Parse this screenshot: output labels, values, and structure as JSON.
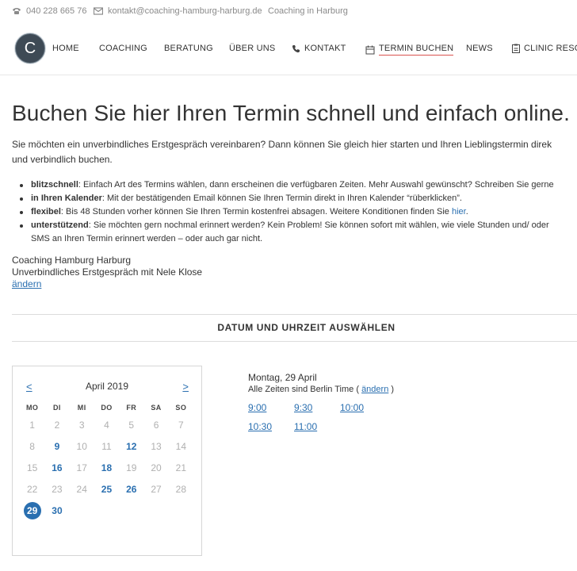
{
  "topbar": {
    "phone": "040 228 665 76",
    "email": "kontakt@coaching-hamburg-harburg.de",
    "tagline": "Coaching in Harburg"
  },
  "logo": {
    "letter": "C"
  },
  "nav": {
    "home": "HOME",
    "coaching": "COACHING",
    "beratung": "BERATUNG",
    "ueber_uns": "ÜBER UNS",
    "kontakt": "KONTAKT",
    "termin": "TERMIN BUCHEN",
    "news": "NEWS",
    "clinic": "CLINIC RESOU"
  },
  "headline": "Buchen Sie hier Ihren Termin schnell und einfach online.",
  "intro": {
    "line1": "Sie möchten ein unverbindliches Erstgespräch vereinbaren? Dann können Sie gleich hier starten und Ihren Lieblingstermin direk",
    "line2": "und verbindlich buchen."
  },
  "bullets": [
    {
      "bold": "blitzschnell",
      "text": ": Einfach Art des Termins wählen, dann erscheinen die verfügbaren Zeiten. Mehr Auswahl gewünscht? Schreiben Sie gerne"
    },
    {
      "bold": "in Ihren Kalender",
      "text": ": Mit der bestätigenden Email können Sie Ihren Termin direkt in Ihren Kalender “rüberklicken”."
    },
    {
      "bold": "flexibel",
      "text": ": Bis 48 Stunden vorher können Sie Ihren Termin kostenfrei absagen. Weitere Konditionen finden Sie ",
      "link": "hier",
      "after": "."
    },
    {
      "bold": "unterstützend",
      "text": ": Sie möchten gern nochmal erinnert werden? Kein Problem! Sie können sofort mit wählen, wie viele Stunden und/ oder",
      "cont": "SMS an Ihren Termin erinnert werden – oder auch gar nicht."
    }
  ],
  "booking": {
    "business": "Coaching Hamburg Harburg",
    "service": "Unverbindliches Erstgespräch mit Nele Klose",
    "change": "ändern"
  },
  "section_title": "DATUM UND UHRZEIT AUSWÄHLEN",
  "calendar": {
    "prev": "<",
    "next": ">",
    "month": "April 2019",
    "weekdays": [
      "MO",
      "DI",
      "MI",
      "DO",
      "FR",
      "SA",
      "SO"
    ],
    "weeks": [
      [
        "1",
        "2",
        "3",
        "4",
        "5",
        "6",
        "7"
      ],
      [
        "8",
        "9",
        "10",
        "11",
        "12",
        "13",
        "14"
      ],
      [
        "15",
        "16",
        "17",
        "18",
        "19",
        "20",
        "21"
      ],
      [
        "22",
        "23",
        "24",
        "25",
        "26",
        "27",
        "28"
      ],
      [
        "29",
        "30"
      ]
    ],
    "available": [
      "9",
      "12",
      "16",
      "18",
      "25",
      "26",
      "29",
      "30"
    ],
    "selected": "29"
  },
  "times": {
    "date": "Montag, 29 April",
    "tz_prefix": "Alle Zeiten sind Berlin Time (",
    "tz_link": "ändern",
    "tz_suffix": ")",
    "slots": [
      [
        "9:00",
        "9:30",
        "10:00"
      ],
      [
        "10:30",
        "11:00"
      ]
    ]
  },
  "colors": {
    "accent": "#2a6fb0",
    "active_underline": "#d9534f",
    "logo_bg": "#3e4a55"
  }
}
